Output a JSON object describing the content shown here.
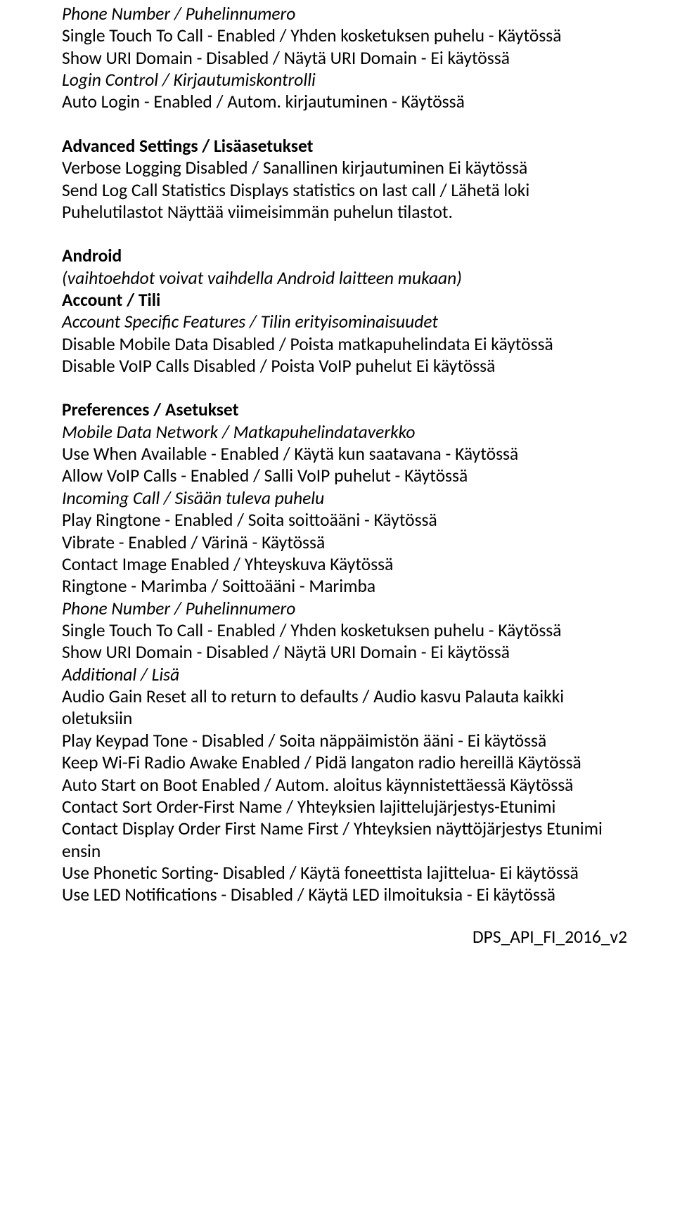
{
  "sec1": {
    "h1": "Phone Number / Puhelinnumero",
    "l1": "Single Touch To Call - Enabled / Yhden kosketuksen puhelu - Käytössä",
    "l2": "Show URI Domain - Disabled / Näytä URI Domain - Ei käytössä",
    "h2": "Login Control / Kirjautumiskontrolli",
    "l3": "Auto Login - Enabled / Autom. kirjautuminen - Käytössä"
  },
  "sec2": {
    "h1": "Advanced Settings / Lisäasetukset",
    "l1": "Verbose Logging Disabled / Sanallinen kirjautuminen Ei käytössä",
    "l2": "Send Log Call Statistics Displays statistics on last call / Lähetä loki Puhelutilastot Näyttää viimeisimmän puhelun tilastot."
  },
  "sec3": {
    "h1": "Android",
    "h2": "(vaihtoehdot voivat vaihdella Android laitteen mukaan)",
    "h3": "Account / Tili",
    "h4": "Account Specific Features / Tilin erityisominaisuudet",
    "l1": "Disable Mobile Data Disabled / Poista matkapuhelindata Ei käytössä",
    "l2": "Disable VoIP Calls Disabled / Poista VoIP puhelut Ei käytössä"
  },
  "sec4": {
    "h1": "Preferences / Asetukset",
    "h2": "Mobile Data Network / Matkapuhelindataverkko",
    "l1": "Use When Available - Enabled / Käytä kun saatavana - Käytössä",
    "l2": "Allow VoIP Calls - Enabled / Salli VoIP puhelut - Käytössä",
    "h3": "Incoming Call / Sisään tuleva puhelu",
    "l3": "Play Ringtone - Enabled / Soita soittoääni - Käytössä",
    "l4": "Vibrate - Enabled / Värinä - Käytössä",
    "l5": "Contact Image Enabled / Yhteyskuva Käytössä",
    "l6": "Ringtone - Marimba / Soittoääni - Marimba",
    "h4": "Phone Number / Puhelinnumero",
    "l7": "Single Touch To Call - Enabled / Yhden kosketuksen puhelu - Käytössä",
    "l8": "Show URI Domain - Disabled / Näytä URI Domain - Ei käytössä",
    "h5": "Additional / Lisä",
    "l9": "Audio Gain Reset all to return to defaults / Audio kasvu Palauta kaikki oletuksiin",
    "l10": "Play Keypad Tone - Disabled / Soita näppäimistön ääni - Ei käytössä",
    "l11": "Keep Wi-Fi Radio Awake Enabled / Pidä langaton radio hereillä Käytössä",
    "l12": "Auto Start on Boot Enabled / Autom. aloitus käynnistettäessä Käytössä",
    "l13": "Contact Sort Order-First Name / Yhteyksien lajittelujärjestys-Etunimi",
    "l14": "Contact Display Order First Name First / Yhteyksien näyttöjärjestys Etunimi ensin",
    "l15": "Use Phonetic Sorting- Disabled / Käytä foneettista lajittelua- Ei käytössä",
    "l16": "Use LED Notifications - Disabled / Käytä LED ilmoituksia - Ei käytössä"
  },
  "footer": "DPS_API_FI_2016_v2"
}
